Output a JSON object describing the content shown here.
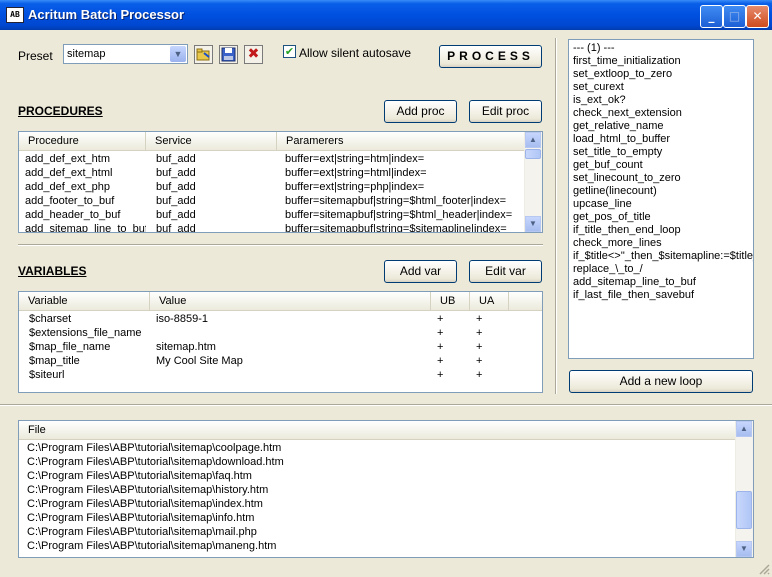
{
  "window": {
    "title": "Acritum Batch Processor",
    "icon_text": "AB"
  },
  "preset": {
    "label": "Preset",
    "selected": "sitemap",
    "allow_autosave_label": "Allow silent autosave",
    "process_label": "PROCESS"
  },
  "procedures": {
    "heading": "PROCEDURES",
    "add_label": "Add proc",
    "edit_label": "Edit proc",
    "columns": [
      "Procedure",
      "Service",
      "Paramerers"
    ],
    "rows": [
      [
        "add_def_ext_htm",
        "buf_add",
        "buffer=ext|string=htm|index="
      ],
      [
        "add_def_ext_html",
        "buf_add",
        "buffer=ext|string=html|index="
      ],
      [
        "add_def_ext_php",
        "buf_add",
        "buffer=ext|string=php|index="
      ],
      [
        "add_footer_to_buf",
        "buf_add",
        "buffer=sitemapbuf|string=$html_footer|index="
      ],
      [
        "add_header_to_buf",
        "buf_add",
        "buffer=sitemapbuf|string=$html_header|index="
      ],
      [
        "add_sitemap_line_to_buf",
        "buf_add",
        "buffer=sitemapbuf|string=$sitemapline|index="
      ]
    ]
  },
  "variables": {
    "heading": "VARIABLES",
    "add_label": "Add var",
    "edit_label": "Edit var",
    "columns": [
      "Variable",
      "Value",
      "UB",
      "UA"
    ],
    "rows": [
      [
        "$charset",
        "iso-8859-1",
        "+",
        "+"
      ],
      [
        "$extensions_file_name",
        "",
        "+",
        "+"
      ],
      [
        "$map_file_name",
        "sitemap.htm",
        "+",
        "+"
      ],
      [
        "$map_title",
        "My Cool Site Map",
        "+",
        "+"
      ],
      [
        "$siteurl",
        "",
        "+",
        "+"
      ]
    ]
  },
  "loop": {
    "items": [
      "--- (1) ---",
      "first_time_initialization",
      "set_extloop_to_zero",
      "set_curext",
      "is_ext_ok?",
      "check_next_extension",
      "get_relative_name",
      "load_html_to_buffer",
      "set_title_to_empty",
      "get_buf_count",
      "set_linecount_to_zero",
      "getline(linecount)",
      "upcase_line",
      "get_pos_of_title",
      "if_title_then_end_loop",
      "check_more_lines",
      "if_$title<>''_then_$sitemapline:=$title_e",
      "replace_\\_to_/",
      "add_sitemap_line_to_buf",
      "if_last_file_then_savebuf"
    ],
    "add_loop_label": "Add a new loop"
  },
  "files": {
    "column": "File",
    "rows": [
      "C:\\Program Files\\ABP\\tutorial\\sitemap\\coolpage.htm",
      "C:\\Program Files\\ABP\\tutorial\\sitemap\\download.htm",
      "C:\\Program Files\\ABP\\tutorial\\sitemap\\faq.htm",
      "C:\\Program Files\\ABP\\tutorial\\sitemap\\history.htm",
      "C:\\Program Files\\ABP\\tutorial\\sitemap\\index.htm",
      "C:\\Program Files\\ABP\\tutorial\\sitemap\\info.htm",
      "C:\\Program Files\\ABP\\tutorial\\sitemap\\mail.php",
      "C:\\Program Files\\ABP\\tutorial\\sitemap\\maneng.htm"
    ]
  },
  "icons": {
    "minimize": "minimize-icon",
    "maximize": "maximize-icon",
    "close": "close-icon",
    "open": "open-folder-icon",
    "save": "floppy-disk-icon",
    "delete": "delete-x-icon"
  },
  "colors": {
    "titlebar": "#0050e0",
    "face": "#ece9d8",
    "border": "#7f9db9",
    "close": "#cf4b1e"
  }
}
